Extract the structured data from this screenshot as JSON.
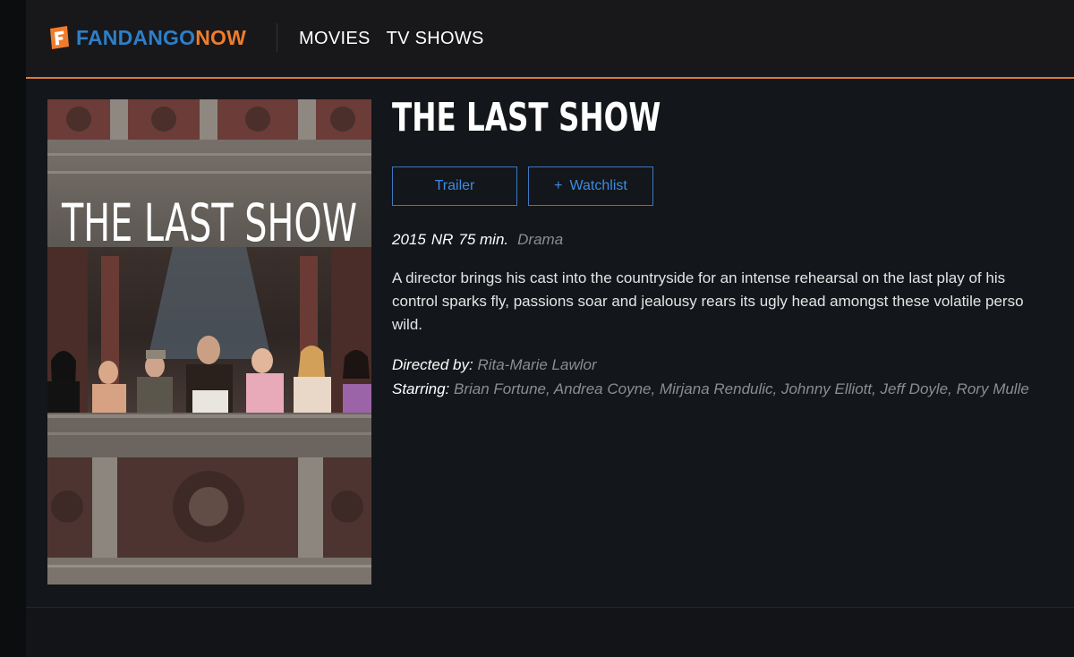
{
  "header": {
    "logo": {
      "part1": "FANDANGO",
      "part2": "NOW"
    },
    "nav": [
      {
        "label": "MOVIES"
      },
      {
        "label": "TV SHOWS"
      }
    ]
  },
  "movie": {
    "title": "THE LAST SHOW",
    "poster_title": "THE LAST SHOW",
    "buttons": {
      "trailer": "Trailer",
      "watchlist_plus": "+",
      "watchlist": "Watchlist"
    },
    "meta": {
      "year": "2015",
      "rating": "NR",
      "runtime": "75 min.",
      "genre": "Drama"
    },
    "synopsis_lines": [
      "A director brings his cast into the countryside for an intense rehearsal on the last play of his",
      "control sparks fly, passions soar and jealousy rears its ugly head amongst these volatile perso",
      "wild."
    ],
    "credits": {
      "directed_label": "Directed by:",
      "director": "Rita-Marie Lawlor",
      "starring_label": "Starring:",
      "starring": "Brian Fortune, Andrea Coyne, Mirjana Rendulic, Johnny Elliott, Jeff Doyle, Rory Mulle"
    }
  },
  "colors": {
    "accent_orange": "#ef7c2c",
    "brand_blue": "#2e7fc8",
    "button_blue": "#3e8be2"
  }
}
